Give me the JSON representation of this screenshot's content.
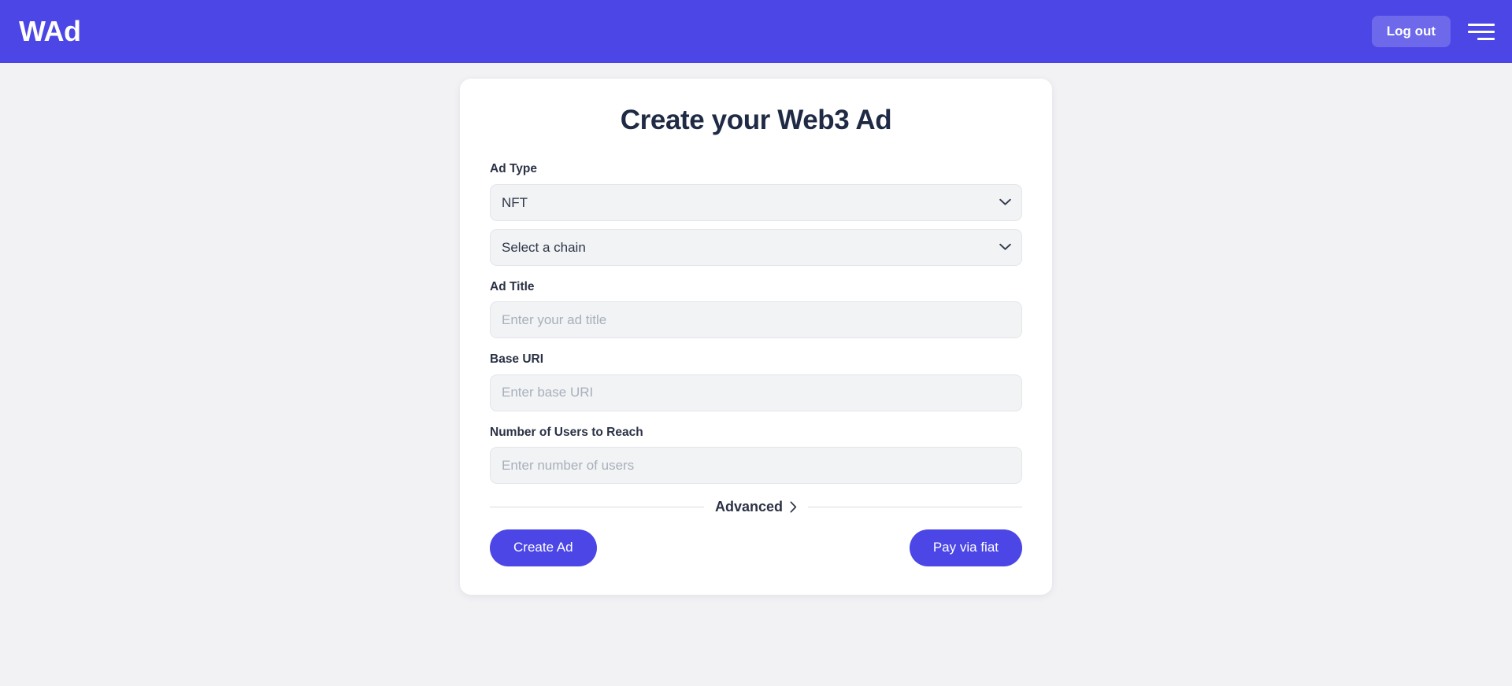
{
  "header": {
    "brand": "WAd",
    "logout_label": "Log out",
    "menu_icon": "hamburger-menu-icon",
    "background_color": "#4b46e5",
    "logout_background_color": "#6d69ea"
  },
  "card": {
    "title": "Create your Web3 Ad",
    "fields": {
      "ad_type": {
        "label": "Ad Type",
        "selected": "NFT",
        "options": [
          "NFT"
        ],
        "icon": "chevron-down-icon"
      },
      "chain": {
        "label": "",
        "selected": "Select a chain",
        "options": [
          "Select a chain"
        ],
        "icon": "chevron-down-icon"
      },
      "ad_title": {
        "label": "Ad Title",
        "value": "",
        "placeholder": "Enter your ad title"
      },
      "base_uri": {
        "label": "Base URI",
        "value": "",
        "placeholder": "Enter base URI"
      },
      "users_to_reach": {
        "label": "Number of Users to Reach",
        "value": "",
        "placeholder": "Enter number of users"
      }
    },
    "advanced": {
      "label": "Advanced",
      "icon": "chevron-right-icon"
    },
    "actions": {
      "create_label": "Create Ad",
      "pay_label": "Pay via fiat",
      "button_color": "#4b46e5"
    }
  },
  "theme": {
    "page_background": "#f2f2f5",
    "card_background": "#ffffff",
    "input_background": "#f1f3f5",
    "text_dark": "#2b3245"
  }
}
